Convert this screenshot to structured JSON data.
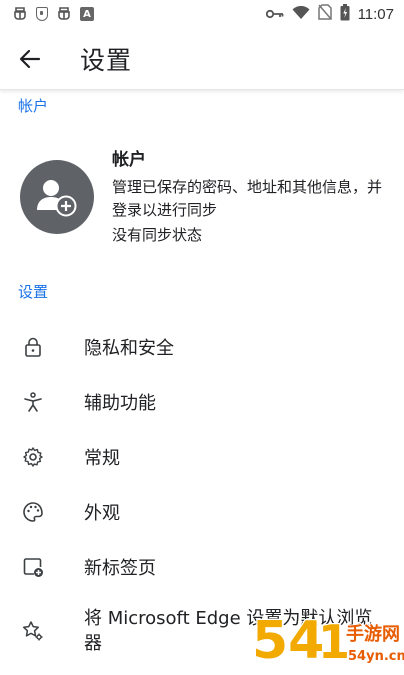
{
  "status_bar": {
    "time": "11:07",
    "left_icons": [
      "bug-icon",
      "shield-icon",
      "bug-icon",
      "a-icon"
    ],
    "right_icons": [
      "key-icon",
      "wifi-icon",
      "no-sim-icon",
      "battery-icon"
    ]
  },
  "app_bar": {
    "title": "设置"
  },
  "account_section": {
    "header": "帐户",
    "title": "帐户",
    "description": "管理已保存的密码、地址和其他信息，并登录以进行同步",
    "status": "没有同步状态"
  },
  "settings_section": {
    "header": "设置",
    "items": [
      {
        "label": "隐私和安全",
        "icon": "lock-icon"
      },
      {
        "label": "辅助功能",
        "icon": "accessibility-icon"
      },
      {
        "label": "常规",
        "icon": "gear-icon"
      },
      {
        "label": "外观",
        "icon": "palette-icon"
      },
      {
        "label": "新标签页",
        "icon": "new-tab-icon"
      },
      {
        "label": "将 Microsoft Edge 设置为默认浏览器",
        "icon": "default-browser-icon"
      }
    ]
  },
  "watermark": {
    "brand": "54 手游网",
    "domain": "54yn.cn"
  },
  "colors": {
    "accent": "#1a73e8",
    "text": "#202124",
    "avatar": "#5f6368",
    "watermark": "#f2a900"
  }
}
